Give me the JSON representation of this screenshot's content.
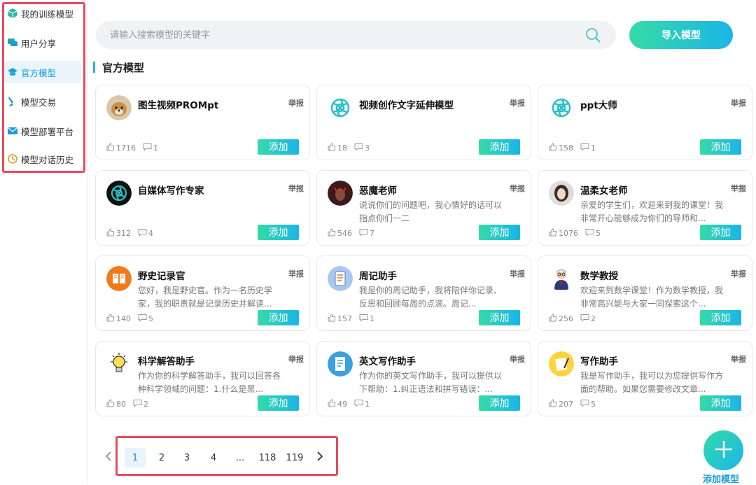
{
  "sidebar": {
    "items": [
      {
        "label": "我的训练模型",
        "icon": "cube-icon"
      },
      {
        "label": "用户分享",
        "icon": "chat-bubbles-icon"
      },
      {
        "label": "官方模型",
        "icon": "graduation-cap-icon"
      },
      {
        "label": "模型交易",
        "icon": "brush-icon"
      },
      {
        "label": "模型部署平台",
        "icon": "envelope-icon"
      },
      {
        "label": "模型对话历史",
        "icon": "history-icon"
      }
    ],
    "active_index": 2
  },
  "search": {
    "placeholder": "请输入搜索模型的关键字",
    "value": ""
  },
  "import_button": "导入模型",
  "section_title": "官方模型",
  "report_label": "举报",
  "add_label": "添加",
  "cards": [
    {
      "name": "图生视频PROMpt",
      "desc": "",
      "likes": "1716",
      "comments": "1",
      "avatar": "dog-photo"
    },
    {
      "name": "视频创作文字延伸模型",
      "desc": "",
      "likes": "18",
      "comments": "3",
      "avatar": "openai-logo"
    },
    {
      "name": "ppt大师",
      "desc": "",
      "likes": "158",
      "comments": "1",
      "avatar": "openai-logo"
    },
    {
      "name": "自媒体写作专家",
      "desc": "",
      "likes": "312",
      "comments": "4",
      "avatar": "openai-logo-dark"
    },
    {
      "name": "恶魔老师",
      "desc": "说说你们的问题吧，我心情好的话可以指点你们一二",
      "likes": "546",
      "comments": "7",
      "avatar": "demon-photo"
    },
    {
      "name": "温柔女老师",
      "desc": "亲爱的学生们，欢迎来到我的课堂！我非常开心能够成为你们的导师和...",
      "likes": "1076",
      "comments": "5",
      "avatar": "woman-photo"
    },
    {
      "name": "野史记录官",
      "desc": "您好，我是野史官。作为一名历史学家，我的职责就是记录历史并解读...",
      "likes": "140",
      "comments": "5",
      "avatar": "book-icon"
    },
    {
      "name": "周记助手",
      "desc": "我是你的周记助手，我将陪伴你记录、反思和回顾每周的点滴。周记...",
      "likes": "157",
      "comments": "1",
      "avatar": "notebook-icon"
    },
    {
      "name": "数学教授",
      "desc": "欢迎来到数学课堂！作为数学教授，我非常高兴能与大家一同探索这个...",
      "likes": "256",
      "comments": "2",
      "avatar": "professor-icon"
    },
    {
      "name": "科学解答助手",
      "desc": "作为你的科学解答助手，我可以回答各种科学领域的问题：1.什么是黑...",
      "likes": "80",
      "comments": "2",
      "avatar": "lightbulb-icon"
    },
    {
      "name": "英文写作助手",
      "desc": "作为你的英文写作助手，我可以提供以下帮助：1.纠正语法和拼写错误：...",
      "likes": "49",
      "comments": "1",
      "avatar": "document-icon"
    },
    {
      "name": "写作助手",
      "desc": "我是写作助手，我可以为您提供写作方面的帮助。如果您需要修改文章...",
      "likes": "207",
      "comments": "5",
      "avatar": "pen-paper-icon"
    }
  ],
  "pagination": {
    "pages": [
      "1",
      "2",
      "3",
      "4",
      "...",
      "118",
      "119"
    ],
    "current": "1"
  },
  "fab_label": "添加模型",
  "colors": {
    "accent": "#1bb5e8",
    "accent_green": "#35dba7",
    "highlight_border": "#e84a5f"
  }
}
